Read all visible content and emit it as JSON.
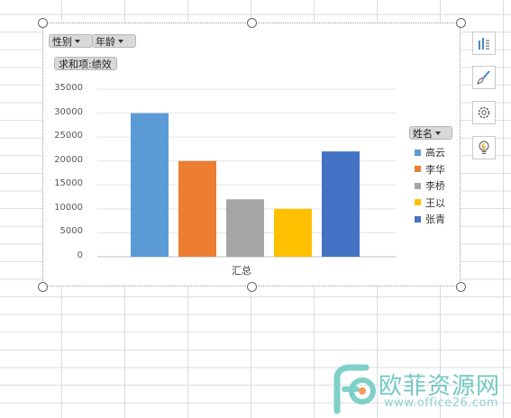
{
  "pivot": {
    "filter_fields": [
      "性别",
      "年龄"
    ],
    "value_field": "求和项:绩效",
    "legend_field": "姓名"
  },
  "colors": {
    "accent": "#5b9bd5",
    "series": [
      "#5b9bd5",
      "#ed7d31",
      "#a5a5a5",
      "#ffc000",
      "#4472c4"
    ]
  },
  "side_toolbar": {
    "icons": [
      "chart-elements-icon",
      "chart-style-icon",
      "chart-settings-icon",
      "chart-ideas-icon"
    ]
  },
  "watermark": {
    "text": "欧菲资源网",
    "url": "www.office26.com"
  },
  "chart_data": {
    "type": "bar",
    "categories": [
      "汇总"
    ],
    "series": [
      {
        "name": "高云",
        "values": [
          30000
        ]
      },
      {
        "name": "李华",
        "values": [
          20000
        ]
      },
      {
        "name": "李桥",
        "values": [
          12000
        ]
      },
      {
        "name": "王以",
        "values": [
          10000
        ]
      },
      {
        "name": "张青",
        "values": [
          22000
        ]
      }
    ],
    "yticks": [
      "35000",
      "30000",
      "25000",
      "20000",
      "15000",
      "10000",
      "5000",
      "0"
    ],
    "ylim": [
      0,
      35000
    ],
    "grid": true,
    "legend_position": "right"
  }
}
